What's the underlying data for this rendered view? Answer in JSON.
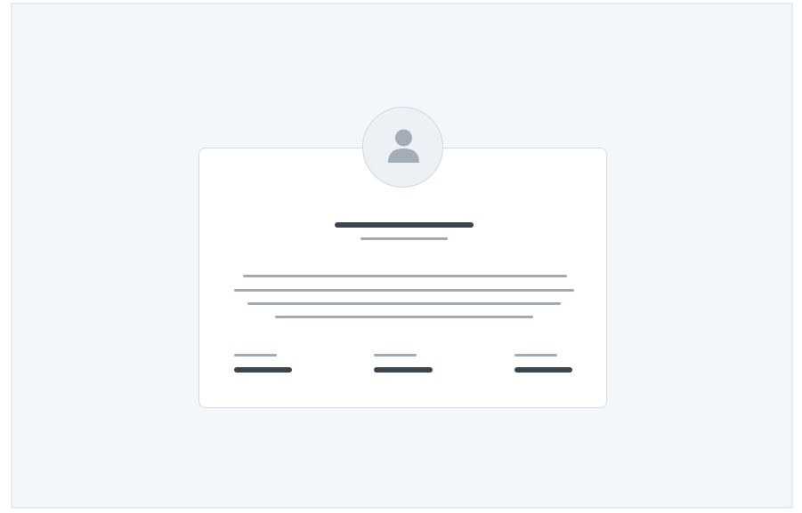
{
  "colors": {
    "canvas_background": "#f3f7fa",
    "card_background": "#ffffff",
    "card_border": "#d4dbe3",
    "placeholder_dark": "#3b4550",
    "placeholder_light": "#9fabb7",
    "avatar_background": "#edf0f4"
  },
  "profile_card": {
    "avatar_icon": "user-icon",
    "title_text": "",
    "subtitle_text": "",
    "bio_lines": [
      "",
      "",
      "",
      ""
    ],
    "stats": [
      {
        "label": "",
        "value": ""
      },
      {
        "label": "",
        "value": ""
      },
      {
        "label": "",
        "value": ""
      }
    ]
  }
}
